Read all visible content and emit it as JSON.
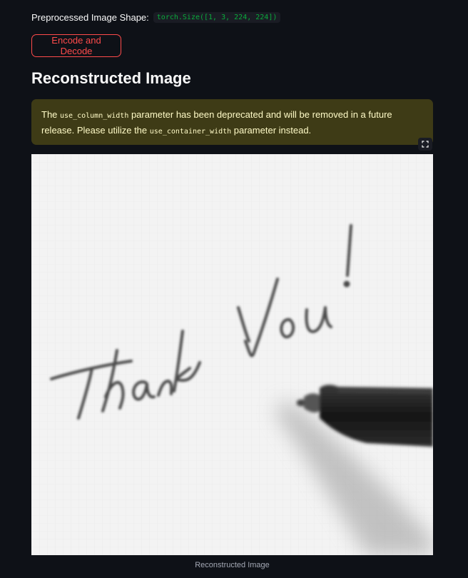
{
  "shape": {
    "label": "Preprocessed Image Shape:",
    "value": "torch.Size([1, 3, 224, 224])"
  },
  "actions": {
    "encode_decode_label": "Encode and Decode"
  },
  "section": {
    "title": "Reconstructed Image"
  },
  "warning": {
    "part1": "The ",
    "code1": "use_column_width",
    "part2": " parameter has been deprecated and will be removed in a future release. Please utilize the ",
    "code2": "use_container_width",
    "part3": " parameter instead."
  },
  "image": {
    "caption": "Reconstructed Image",
    "description": "handwritten-thank-you-note-with-pen"
  },
  "icons": {
    "fullscreen": "fullscreen-icon"
  },
  "colors": {
    "background": "#0e1117",
    "accent": "#ff4b4b",
    "code_green": "#09ab3b",
    "warning_bg": "#3e3b16",
    "warning_text": "#fffbc7"
  }
}
